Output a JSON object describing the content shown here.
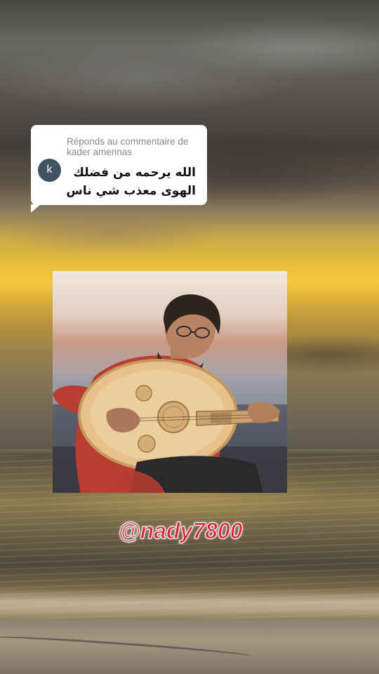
{
  "comment_reply": {
    "header_line1": "Réponds au commentaire de",
    "header_line2": "kader amennas",
    "avatar_initial": "k",
    "text_line1": "الله يرحمه من فضلك",
    "text_line2": "الهوى معذب شي ناس"
  },
  "watermark": {
    "text": "@nady7800",
    "color": "#d9283a"
  },
  "icons": {
    "avatar": "user-initial-avatar",
    "sticker_tail": "speech-bubble-tail"
  },
  "colors": {
    "sticker_background": "#ffffff",
    "header_text": "#8a8a8a",
    "avatar_background": "#415261"
  }
}
